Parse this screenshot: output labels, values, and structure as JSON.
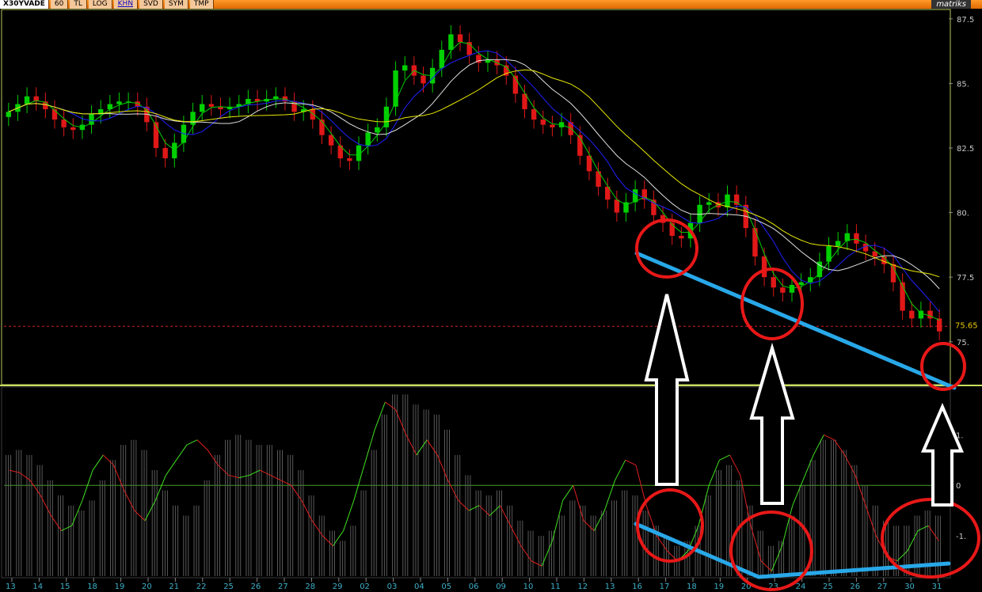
{
  "toolbar": {
    "symbol": "X30YVADE",
    "items": [
      "60",
      "TL",
      "LOG",
      "KHN",
      "SVD",
      "SYM",
      "TMP"
    ],
    "logo": "matriks"
  },
  "chart_data": [
    {
      "type": "candlestick",
      "panel": "price",
      "y_ticks": [
        "87.5",
        "85.",
        "82.5",
        "80.",
        "77.5",
        "75."
      ],
      "ylim": [
        73.4,
        87.8
      ],
      "last_price_label": "75.65",
      "reference_line": 75.6,
      "series": [
        {
          "name": "",
          "color": "#00d000"
        },
        {
          "name": "",
          "color": "#2020ff"
        },
        {
          "name": "",
          "color": "#e0e0e0"
        },
        {
          "name": "",
          "color": "#e8e800"
        }
      ],
      "close": [
        83.9,
        84.2,
        84.5,
        84.3,
        84.0,
        83.6,
        83.3,
        83.2,
        83.4,
        83.8,
        84.0,
        84.2,
        84.3,
        84.3,
        84.1,
        83.5,
        82.5,
        82.1,
        82.7,
        83.4,
        83.9,
        84.2,
        84.1,
        84.0,
        84.1,
        84.2,
        84.4,
        84.3,
        84.4,
        84.5,
        84.3,
        83.9,
        84.0,
        83.6,
        83.0,
        82.6,
        82.1,
        82.0,
        82.6,
        83.1,
        83.3,
        84.1,
        85.5,
        85.7,
        85.3,
        85.0,
        85.6,
        86.3,
        86.9,
        86.6,
        86.1,
        85.8,
        85.9,
        85.7,
        85.3,
        84.6,
        84.0,
        83.6,
        83.4,
        83.3,
        83.5,
        83.0,
        82.2,
        81.6,
        81.0,
        80.5,
        80.0,
        80.4,
        80.9,
        80.5,
        79.9,
        79.6,
        79.1,
        79.0,
        79.6,
        80.3,
        80.4,
        80.2,
        80.7,
        80.3,
        79.4,
        78.3,
        77.5,
        77.1,
        76.9,
        77.2,
        77.3,
        77.5,
        78.1,
        78.7,
        78.9,
        79.2,
        78.8,
        78.5,
        78.3,
        78.0,
        77.3,
        76.2,
        75.9,
        76.2,
        75.9,
        75.4
      ]
    },
    {
      "type": "oscillator",
      "panel": "indicator",
      "y_ticks": [
        "1.",
        "0",
        "-1."
      ],
      "ylim": [
        -1.8,
        1.9
      ],
      "x_tick_labels": [
        "13",
        "14",
        "15",
        "18",
        "19",
        "20",
        "21",
        "22",
        "25",
        "26",
        "27",
        "28",
        "29",
        "02",
        "03",
        "04",
        "05",
        "06",
        "09",
        "10",
        "11",
        "12",
        "13",
        "16",
        "17",
        "18",
        "19",
        "20",
        "23",
        "24",
        "25",
        "26",
        "27",
        "30",
        "31"
      ],
      "line": [
        0.3,
        0.25,
        0.1,
        -0.2,
        -0.6,
        -0.9,
        -0.8,
        -0.3,
        0.3,
        0.6,
        0.4,
        -0.1,
        -0.5,
        -0.7,
        -0.3,
        0.2,
        0.5,
        0.8,
        0.9,
        0.7,
        0.4,
        0.2,
        0.15,
        0.2,
        0.3,
        0.2,
        0.1,
        0.0,
        -0.3,
        -0.7,
        -1.0,
        -1.2,
        -0.9,
        -0.3,
        0.4,
        1.1,
        1.65,
        1.5,
        1.0,
        0.6,
        0.9,
        0.6,
        0.1,
        -0.3,
        -0.5,
        -0.4,
        -0.6,
        -0.4,
        -0.8,
        -1.2,
        -1.5,
        -1.6,
        -1.1,
        -0.3,
        0.0,
        -0.7,
        -0.9,
        -0.5,
        0.1,
        0.5,
        0.4,
        -0.4,
        -1.0,
        -1.3,
        -1.5,
        -1.3,
        -0.8,
        0.0,
        0.5,
        0.6,
        0.2,
        -0.8,
        -1.5,
        -1.7,
        -1.2,
        -0.4,
        0.1,
        0.6,
        1.0,
        0.9,
        0.6,
        0.2,
        -0.4,
        -1.0,
        -1.4,
        -1.5,
        -1.3,
        -0.9,
        -0.8,
        -1.1
      ],
      "histogram": [
        0.6,
        0.7,
        0.6,
        0.4,
        0.1,
        -0.2,
        -0.4,
        -0.5,
        -0.3,
        0.1,
        0.5,
        0.8,
        0.9,
        0.7,
        0.3,
        -0.1,
        -0.4,
        -0.6,
        -0.4,
        0.1,
        0.6,
        0.9,
        1.0,
        0.9,
        0.8,
        0.8,
        0.7,
        0.6,
        0.3,
        -0.2,
        -0.6,
        -0.9,
        -1.1,
        -0.8,
        -0.1,
        0.7,
        1.4,
        1.8,
        1.8,
        1.6,
        1.5,
        1.4,
        1.1,
        0.6,
        0.2,
        -0.1,
        -0.2,
        -0.1,
        -0.4,
        -0.7,
        -0.9,
        -1.0,
        -0.9,
        -0.6,
        -0.3,
        -0.4,
        -0.6,
        -0.5,
        -0.3,
        -0.1,
        -0.2,
        -0.5,
        -0.8,
        -1.0,
        -1.2,
        -1.1,
        -0.8,
        -0.2,
        0.3,
        0.4,
        0.1,
        -0.4,
        -0.9,
        -1.2,
        -1.1,
        -0.6,
        0.0,
        0.5,
        0.9,
        0.9,
        0.7,
        0.4,
        0.0,
        -0.4,
        -0.7,
        -0.8,
        -0.8,
        -0.6,
        -0.5,
        -0.6
      ]
    }
  ],
  "annotations": {
    "red_circles": 6,
    "up_arrows": 3,
    "trendlines_blue": 3
  }
}
